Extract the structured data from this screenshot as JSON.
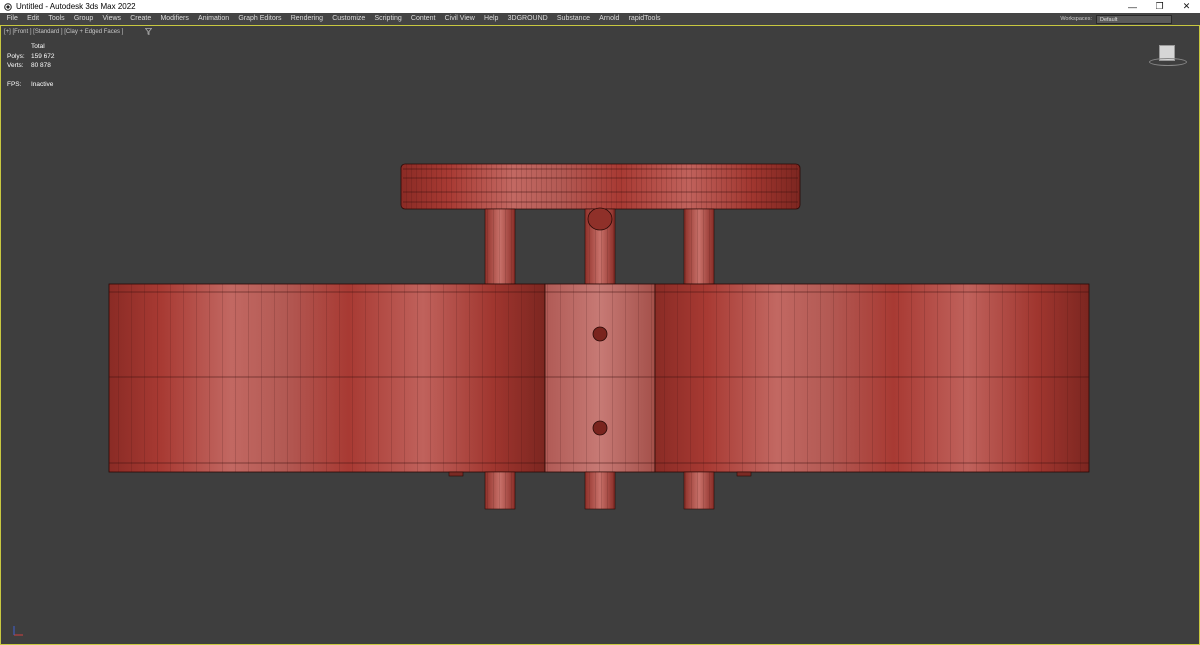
{
  "window": {
    "title": "Untitled - Autodesk 3ds Max 2022",
    "minimize_glyph": "—",
    "restore_glyph": "❐",
    "close_glyph": "✕"
  },
  "menu": {
    "items": [
      "File",
      "Edit",
      "Tools",
      "Group",
      "Views",
      "Create",
      "Modifiers",
      "Animation",
      "Graph Editors",
      "Rendering",
      "Customize",
      "Scripting",
      "Content",
      "Civil View",
      "Help",
      "3DGROUND",
      "Substance",
      "Arnold",
      "rapidTools"
    ],
    "workspaces_label": "Workspaces:",
    "workspaces_value": "Default"
  },
  "viewport": {
    "label": "[+] [Front ] [Standard ] [Clay + Edged Faces ]",
    "filter_icon": "funnel-icon",
    "stats": {
      "header": "Total",
      "polys_label": "Polys:",
      "polys_value": "159 672",
      "verts_label": "Verts:",
      "verts_value": "80 878",
      "fps_label": "FPS:",
      "fps_value": "Inactive"
    },
    "border_color": "#c8c840",
    "model_color": "#a83a33"
  }
}
